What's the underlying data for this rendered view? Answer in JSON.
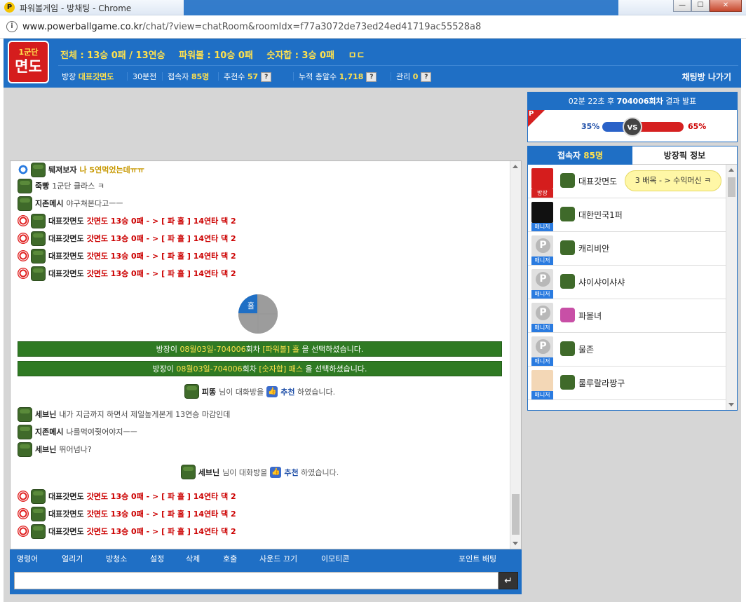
{
  "window": {
    "title": "파워볼게임 - 방채팅 - Chrome",
    "app_icon": "P",
    "url_host": "www.powerballgame.co.kr",
    "url_path": "/chat/?view=chatRoom&roomIdx=f77a3072de73ed24ed41719ac55528a8",
    "minimize": "—",
    "maximize": "☐",
    "close": "✕",
    "info_icon": "i"
  },
  "header": {
    "logo_top": "1군단",
    "logo_main": "면도",
    "stats": [
      "전체 : 13승 0패 / 13연승",
      "파워볼 : 10승 0패",
      "숫자합 : 3승 0패",
      "ㅁㄷ"
    ],
    "host_label": "방장",
    "host_name": "대표갓면도",
    "duration": "30분전",
    "users_label": "접속자",
    "users_count": "85명",
    "recommend_label": "추천수",
    "recommend_count": "57",
    "cum_label": "누적 총알수",
    "cum_count": "1,718",
    "manage_label": "관리",
    "manage_count": "0",
    "q": "?",
    "exit": "채팅방 나가기"
  },
  "chat": {
    "messages": [
      {
        "nick": "뒈져보자",
        "text": "나 5연먹었는데ㅠㅠ",
        "style": "y",
        "icon": "blue"
      },
      {
        "nick": "죽빵",
        "text": "1군단 클라스 ㅋ",
        "style": "",
        "icon": "none"
      },
      {
        "nick": "지존메시",
        "text": "야구쳐본다고ㅡㅡ",
        "style": "",
        "icon": "none"
      },
      {
        "nick": "대표갓면도",
        "text": "갓면도 13승 0패 - > [ 파 홀 ] 14연타 댁 2",
        "style": "r",
        "icon": "red"
      },
      {
        "nick": "대표갓면도",
        "text": "갓면도 13승 0패 - > [ 파 홀 ] 14연타 댁 2",
        "style": "r",
        "icon": "red"
      },
      {
        "nick": "대표갓면도",
        "text": "갓면도 13승 0패 - > [ 파 홀 ] 14연타 댁 2",
        "style": "r",
        "icon": "red"
      },
      {
        "nick": "대표갓면도",
        "text": "갓면도 13승 0패 - > [ 파 홀 ] 14연타 댁 2",
        "style": "r",
        "icon": "red"
      }
    ],
    "pie_label": "홀",
    "system1": {
      "pre": "방장이 ",
      "date": "08월03일-704006",
      "mid": "회차 ",
      "pick": "[파워볼] 홀",
      "post": " 을 선택하셨습니다."
    },
    "system2": {
      "pre": "방장이 ",
      "date": "08월03일-704006",
      "mid": "회차 ",
      "pick": "[숫자합] 패스",
      "post": " 을 선택하셨습니다."
    },
    "recommend1": {
      "nick": "피똥",
      "pre": "님이 대화방을",
      "action": "추천",
      "post": "하였습니다."
    },
    "messages2": [
      {
        "nick": "세브닌",
        "text": "내가 지금까지 하면서 제일높게본게 13연승 마감인데",
        "style": "",
        "icon": "none"
      },
      {
        "nick": "지존메시",
        "text": "나를먹여줫어야지ㅡㅡ",
        "style": "",
        "icon": "none"
      },
      {
        "nick": "세브닌",
        "text": "뛰어넘나?",
        "style": "",
        "icon": "none"
      }
    ],
    "recommend2": {
      "nick": "세브닌",
      "pre": "님이 대화방을",
      "action": "추천",
      "post": "하였습니다."
    },
    "messages3": [
      {
        "nick": "대표갓면도",
        "text": "갓면도 13승 0패 - > [ 파 홀 ] 14연타 댁 2",
        "style": "r",
        "icon": "red"
      },
      {
        "nick": "대표갓면도",
        "text": "갓면도 13승 0패 - > [ 파 홀 ] 14연타 댁 2",
        "style": "r",
        "icon": "red"
      },
      {
        "nick": "대표갓면도",
        "text": "갓면도 13승 0패 - > [ 파 홀 ] 14연타 댁 2",
        "style": "r",
        "icon": "red"
      }
    ]
  },
  "toolbar": {
    "items": [
      "명령어",
      "얼리기",
      "방청소",
      "설정",
      "삭제",
      "호출",
      "사운드 끄기",
      "이모티콘"
    ],
    "right": "포인트 배팅",
    "send": "↵"
  },
  "result": {
    "header_pre": "02분 22초 후 ",
    "round": "704006회차",
    "header_post": " 결과 발표",
    "p": "P",
    "left_pct": "35%",
    "right_pct": "65%",
    "vs": "VS"
  },
  "users": {
    "tab_label": "접속자",
    "tab_count": "85명",
    "tab2": "방장픽 정보",
    "list": [
      {
        "name": "대표갓면도",
        "tag": "방장",
        "avatar": "red",
        "bubble": "3 배목 - > 수익머신 ㅋ"
      },
      {
        "name": "대한민국1퍼",
        "tag": "매니저",
        "avatar": "black",
        "bubble": ""
      },
      {
        "name": "캐리비안",
        "tag": "매니저",
        "avatar": "gray",
        "bubble": ""
      },
      {
        "name": "샤이샤이샤샤",
        "tag": "매니저",
        "avatar": "gray",
        "bubble": ""
      },
      {
        "name": "파볼녀",
        "tag": "매니저",
        "avatar": "gray",
        "bubble": ""
      },
      {
        "name": "물존",
        "tag": "매니저",
        "avatar": "gray",
        "bubble": ""
      },
      {
        "name": "룰루랄라짱구",
        "tag": "매니저",
        "avatar": "cartoon",
        "bubble": ""
      }
    ]
  }
}
